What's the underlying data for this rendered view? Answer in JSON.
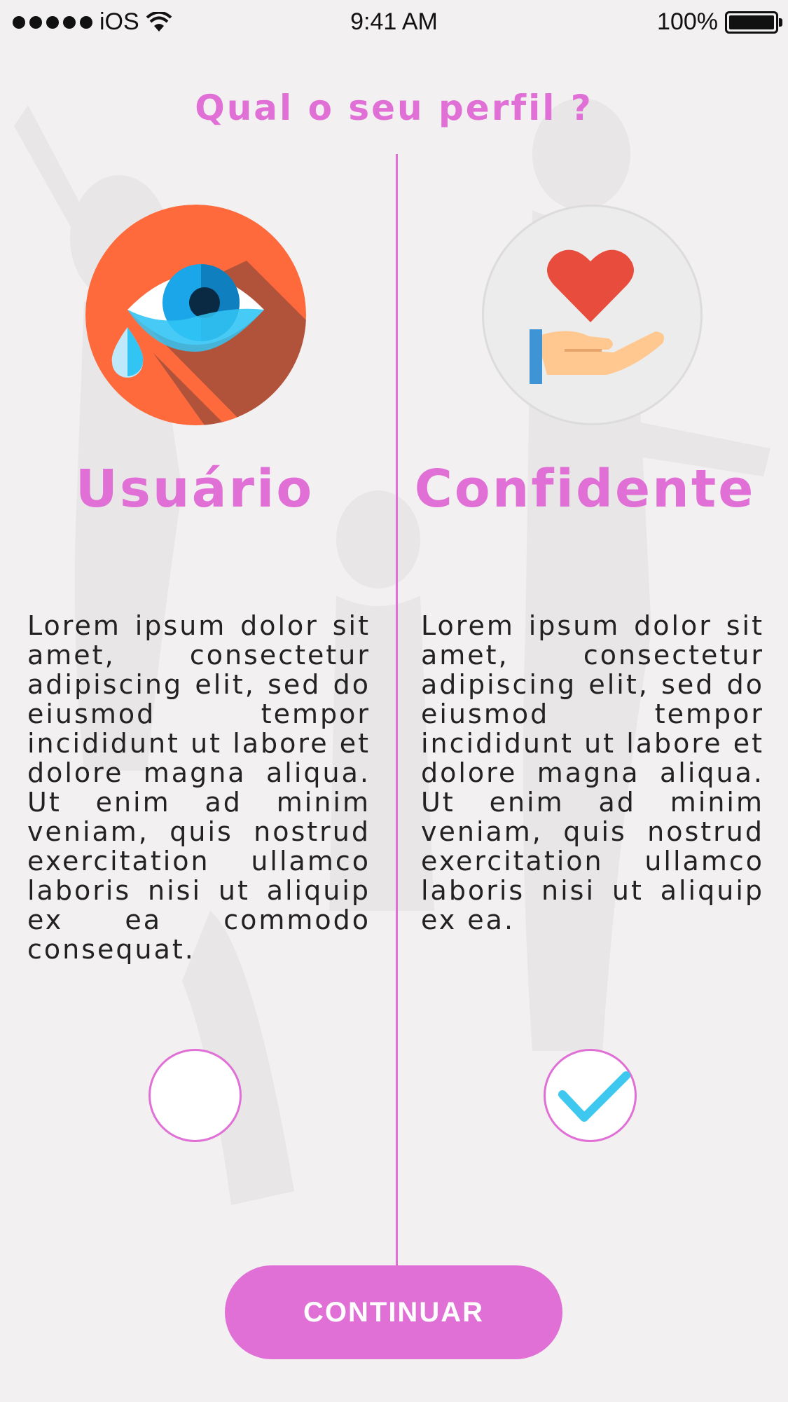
{
  "status_bar": {
    "carrier": "iOS",
    "time": "9:41 AM",
    "battery_percent": "100%",
    "icons": [
      "signal-dots-icon",
      "wifi-icon",
      "battery-icon"
    ]
  },
  "title": "Qual o seu perfil ?",
  "profiles": [
    {
      "name": "Usuário",
      "icon": "crying-eye-icon",
      "description": "Lorem ipsum dolor sit amet, consectetur adipiscing elit, sed do eiusmod tempor incididunt ut labore et dolore magna aliqua. Ut enim ad minim veniam, quis nostrud exercitation ullamco laboris nisi ut aliquip ex ea commodo consequat.",
      "selected": false
    },
    {
      "name": "Confidente",
      "icon": "heart-in-hand-icon",
      "description": "Lorem ipsum dolor sit amet, consectetur adipiscing elit, sed do eiusmod tempor incididunt ut labore et dolore magna aliqua. Ut enim ad minim veniam, quis nostrud exercitation ullamco laboris nisi ut aliquip ex ea.",
      "selected": true
    }
  ],
  "continue_label": "CONTINUAR",
  "colors": {
    "accent": "#e06fd6",
    "check": "#3fc8ef",
    "eye_circle": "#ff6a3d",
    "heart": "#e74c3c"
  }
}
